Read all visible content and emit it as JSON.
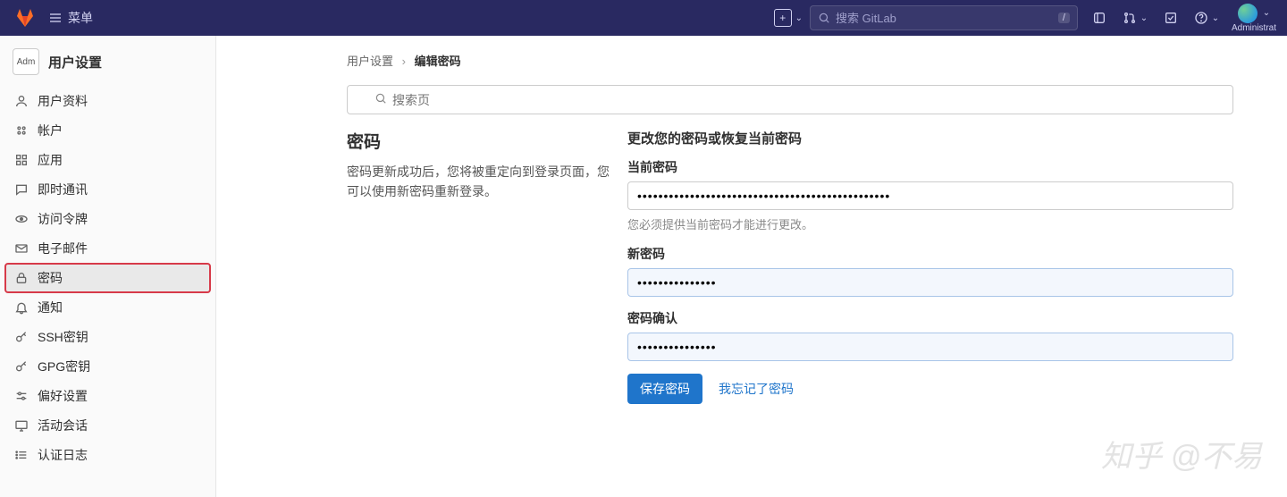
{
  "navbar": {
    "menu_label": "菜单",
    "search_placeholder": "搜索 GitLab",
    "search_shortcut": "/",
    "user_label": "Administrat"
  },
  "sidebar": {
    "avatar_text": "Adm",
    "title": "用户设置",
    "items": [
      {
        "label": "用户资料",
        "icon": "user-icon"
      },
      {
        "label": "帐户",
        "icon": "gear-icon"
      },
      {
        "label": "应用",
        "icon": "apps-icon"
      },
      {
        "label": "即时通讯",
        "icon": "chat-icon"
      },
      {
        "label": "访问令牌",
        "icon": "token-icon"
      },
      {
        "label": "电子邮件",
        "icon": "mail-icon"
      },
      {
        "label": "密码",
        "icon": "lock-icon",
        "active": true
      },
      {
        "label": "通知",
        "icon": "bell-icon"
      },
      {
        "label": "SSH密钥",
        "icon": "key-icon"
      },
      {
        "label": "GPG密钥",
        "icon": "key-icon"
      },
      {
        "label": "偏好设置",
        "icon": "sliders-icon"
      },
      {
        "label": "活动会话",
        "icon": "monitor-icon"
      },
      {
        "label": "认证日志",
        "icon": "list-icon"
      }
    ]
  },
  "breadcrumb": {
    "parent": "用户设置",
    "current": "编辑密码"
  },
  "page_search_placeholder": "搜索页",
  "password_section": {
    "heading": "密码",
    "description": "密码更新成功后，您将被重定向到登录页面，您可以使用新密码重新登录。",
    "subheading": "更改您的密码或恢复当前密码",
    "current_label": "当前密码",
    "current_value": "••••••••••••••••••••••••••••••••••••••••••••••••",
    "current_hint": "您必须提供当前密码才能进行更改。",
    "new_label": "新密码",
    "new_value": "•••••••••••••••",
    "confirm_label": "密码确认",
    "confirm_value": "•••••••••••••••",
    "save_button": "保存密码",
    "forgot_link": "我忘记了密码"
  },
  "watermark": "知乎 @不易"
}
